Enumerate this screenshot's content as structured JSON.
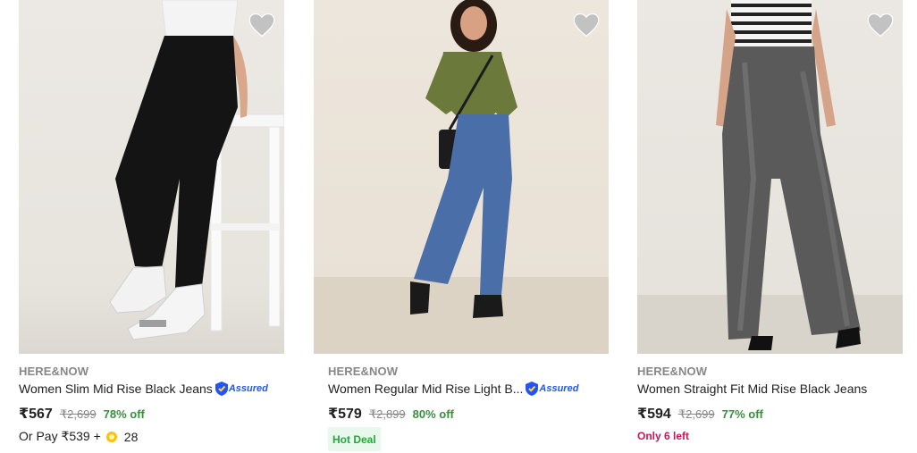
{
  "products": [
    {
      "brand": "HERE&NOW",
      "title": "Women Slim Mid Rise Black Jeans",
      "assured_label": "Assured",
      "price": "₹567",
      "mrp": "₹2,699",
      "discount": "78% off",
      "pay_with_coins": "Or Pay ₹539 +",
      "coins": "28",
      "wishlist_icon": "heart-icon"
    },
    {
      "brand": "HERE&NOW",
      "title": "Women Regular Mid Rise Light B...",
      "assured_label": "Assured",
      "price": "₹579",
      "mrp": "₹2,899",
      "discount": "80% off",
      "badge": "Hot Deal",
      "wishlist_icon": "heart-icon"
    },
    {
      "brand": "HERE&NOW",
      "title": "Women Straight Fit Mid Rise Black Jeans",
      "price": "₹594",
      "mrp": "₹2,699",
      "discount": "77% off",
      "stock_note": "Only 6 left",
      "wishlist_icon": "heart-icon"
    }
  ],
  "colors": {
    "discount_green": "#388e3c",
    "assured_blue": "#2455f4",
    "stock_pink": "#c8175a",
    "hot_deal_bg": "#e8f8ec"
  }
}
